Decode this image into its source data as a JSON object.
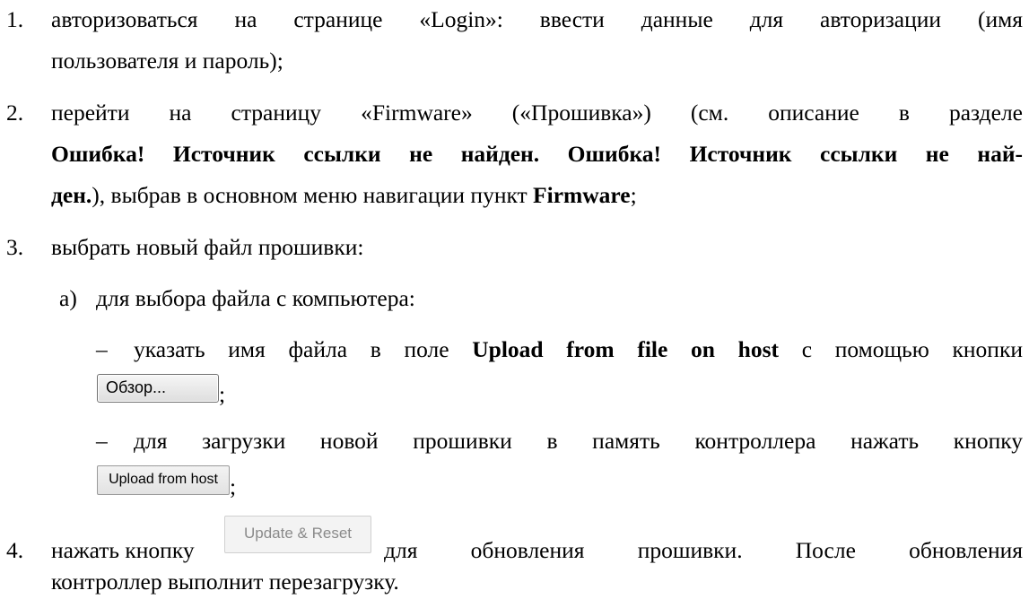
{
  "items": [
    {
      "number": "1.",
      "lines": [
        "авторизоваться на странице «Login»: ввести данные для авторизации (имя",
        "пользователя и пароль);"
      ]
    },
    {
      "number": "2.",
      "line1": "перейти на страницу «Firmware» («Прошивка») (см. описание в разделе",
      "line2_bold": "Ошибка! Источник ссылки не найден. Ошибка! Источник ссылки не най-",
      "line3_bold": "ден.",
      "line3_rest": "), выбрав в основном меню навигации пункт ",
      "line3_bold2": "Firmware",
      "line3_end": ";"
    },
    {
      "number": "3.",
      "text": "выбрать новый файл прошивки:",
      "sub_letter": "а)",
      "sub_text": "для выбора файла с компьютера:",
      "bullets": [
        {
          "dash": "–",
          "before": "указать имя файла в поле ",
          "bold": "Upload from file on host",
          "after": " с помощью кнопки",
          "button_label": "Обзор...",
          "end": ";"
        },
        {
          "dash": "–",
          "text": "для загрузки новой прошивки в память контроллера нажать кнопку",
          "button_label": "Upload from host",
          "end": ";"
        }
      ]
    },
    {
      "number": "4.",
      "before": "нажать кнопку",
      "button_label": "Update & Reset",
      "after": "для обновления прошивки. После обновления",
      "line2": "контроллер выполнит перезагрузку."
    }
  ]
}
